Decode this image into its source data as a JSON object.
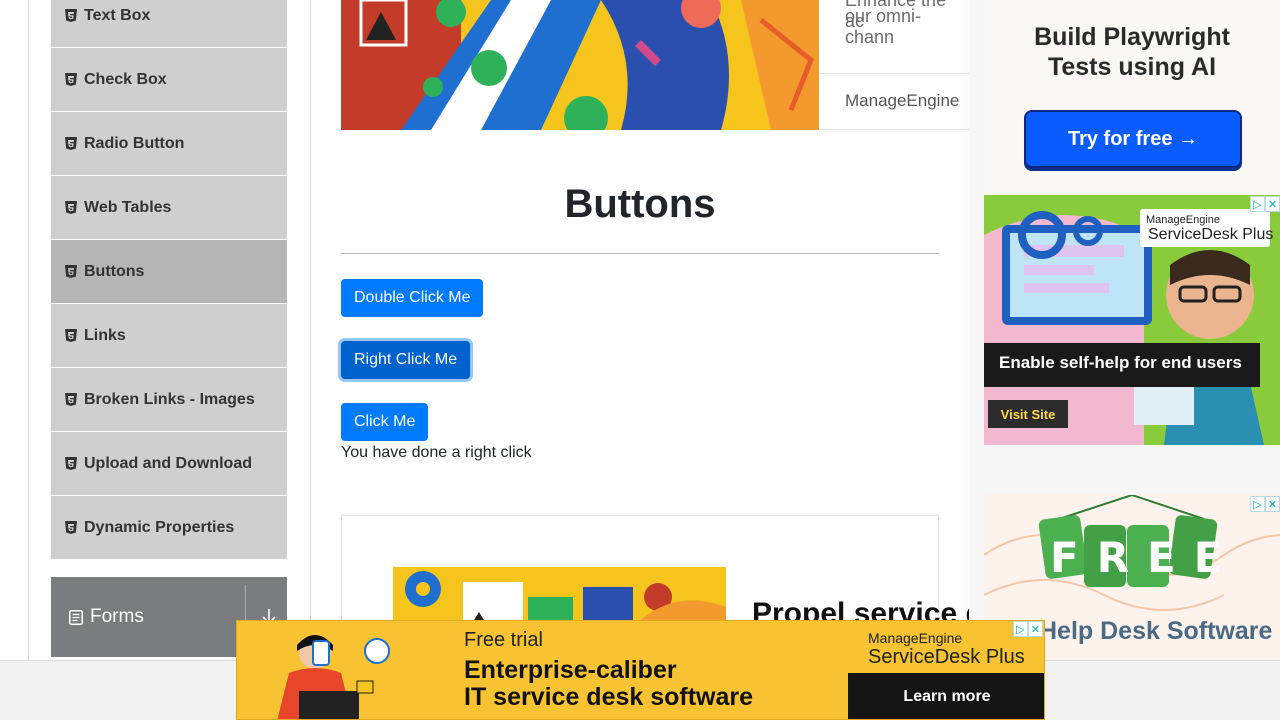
{
  "sidebar": {
    "items": [
      {
        "label": "Text Box",
        "icon": "html5-icon"
      },
      {
        "label": "Check Box",
        "icon": "html5-icon"
      },
      {
        "label": "Radio Button",
        "icon": "html5-icon"
      },
      {
        "label": "Web Tables",
        "icon": "html5-icon"
      },
      {
        "label": "Buttons",
        "icon": "html5-icon",
        "active": true
      },
      {
        "label": "Links",
        "icon": "html5-icon"
      },
      {
        "label": "Broken Links - Images",
        "icon": "html5-icon"
      },
      {
        "label": "Upload and Download",
        "icon": "html5-icon"
      },
      {
        "label": "Dynamic Properties",
        "icon": "html5-icon"
      }
    ],
    "group": {
      "label": "Forms",
      "icon": "document-icon",
      "toggle_icon": "arrow-down-icon"
    }
  },
  "top_ad": {
    "text_line1": "Enhance the ac",
    "text_line2": "our omni-chann",
    "brand": "ManageEngine"
  },
  "main": {
    "title": "Buttons",
    "double_click_label": "Double Click Me",
    "right_click_label": "Right Click Me",
    "click_label": "Click Me",
    "message": "You have done a right click"
  },
  "inner_ad": {
    "headline": "Propel service d"
  },
  "rail": {
    "playwright_ad": {
      "title_line1": "Build Playwright",
      "title_line2": "Tests using AI",
      "cta": "Try for free →"
    },
    "servicedesk_ad": {
      "brand_small": "ManageEngine",
      "brand_large": "ServiceDesk Plus",
      "tagline": "Enable self-help for end users",
      "cta": "Visit Site"
    },
    "free_ad": {
      "badge": "FREE",
      "subtitle": "Help Desk Software"
    }
  },
  "bottom_ad": {
    "eyebrow": "Free trial",
    "headline_line1": "Enterprise-caliber",
    "headline_line2": "IT service desk software",
    "brand_small": "ManageEngine",
    "brand_large": "ServiceDesk Plus",
    "cta": "Learn more"
  },
  "colors": {
    "primary": "#007bff",
    "sidebar_item": "#cfcfcf",
    "sidebar_active": "#b5b5b5",
    "group_header": "#7a7c80",
    "ad_yellow": "#f7c332"
  }
}
